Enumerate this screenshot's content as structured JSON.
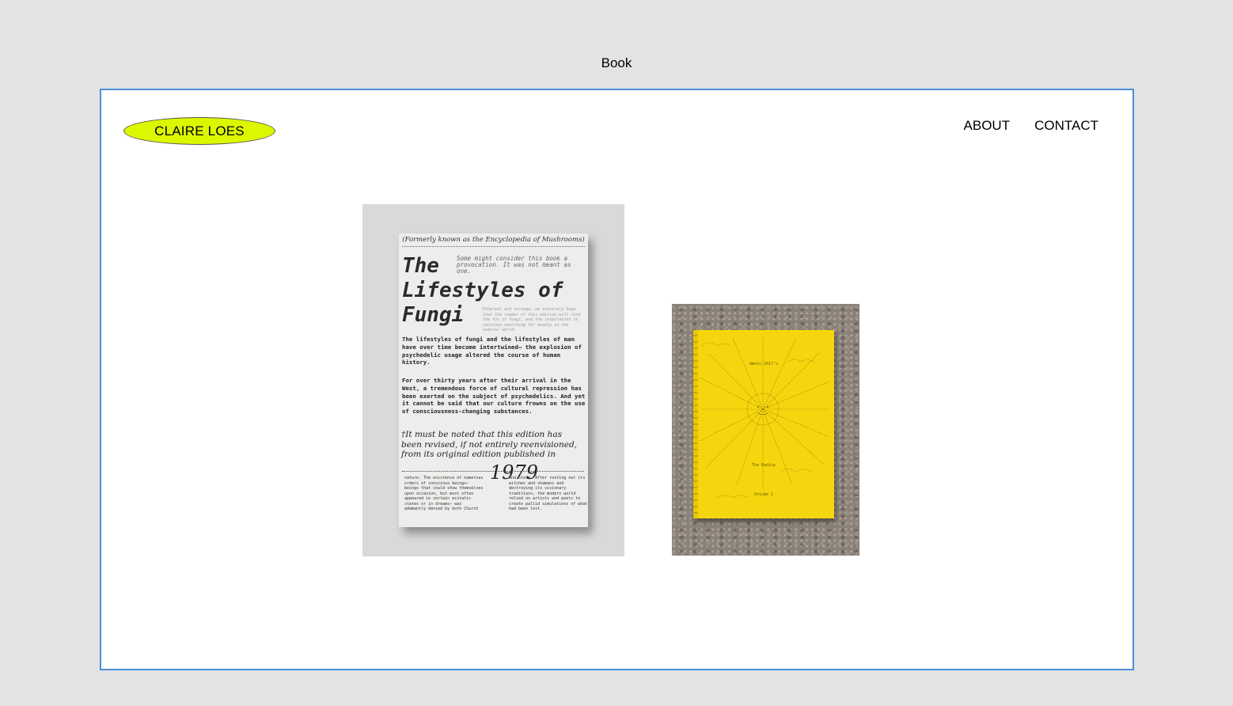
{
  "frame_label": "Book",
  "header": {
    "logo": "CLAIRE LOES",
    "nav": [
      "ABOUT",
      "CONTACT"
    ]
  },
  "colors": {
    "accent": "#dcf700",
    "frame_border": "#4a8fd9",
    "background": "#e3e3e3"
  },
  "books": [
    {
      "cover": {
        "top_line": "(Formerly known as the Encyclopedia of Mushrooms)",
        "title": "The\nLifestyles of\nFungi",
        "note": "Some might consider this book a provocation. It was not meant as one.",
        "small_note": "Ethereal and strange, we sincerely hope that the reader of this edition will find the fun in fungi, and the inspiration to continue searching for beauty in the natural world.",
        "paragraph_1": "The lifestyles of fungi and the lifestyles of man have over time become intertwined— the explosion of psychedelic usage altered the course of human history.",
        "paragraph_2": "For over thirty years after their arrival in the West, a tremendous force of cultural repression has been exerted on the subject of psychedelics. And yet it cannot be said that our culture frowns on the use of consciousness-changing substances.",
        "italic_note": "†It must be noted that this edition has been revised, if not entirely reenvisioned, from its original edition published in",
        "year": "1979",
        "column_left": "nature. The existence of numerous orders of conscious beings— beings that could show themselves upon occasion, but most often appeared in certain ecstatic states or in dreams— was adamantly denied by both Church",
        "column_right": "and State. After rooting out its witches and shamans and destroying its visionary traditions, the modern world relied on artists and poets to create pallid simulations of what had been lost."
      }
    },
    {
      "cover": {
        "top_text": "Amnis 2017's",
        "middle_text": "The Radice",
        "bottom_text": "Volume 1"
      }
    }
  ]
}
